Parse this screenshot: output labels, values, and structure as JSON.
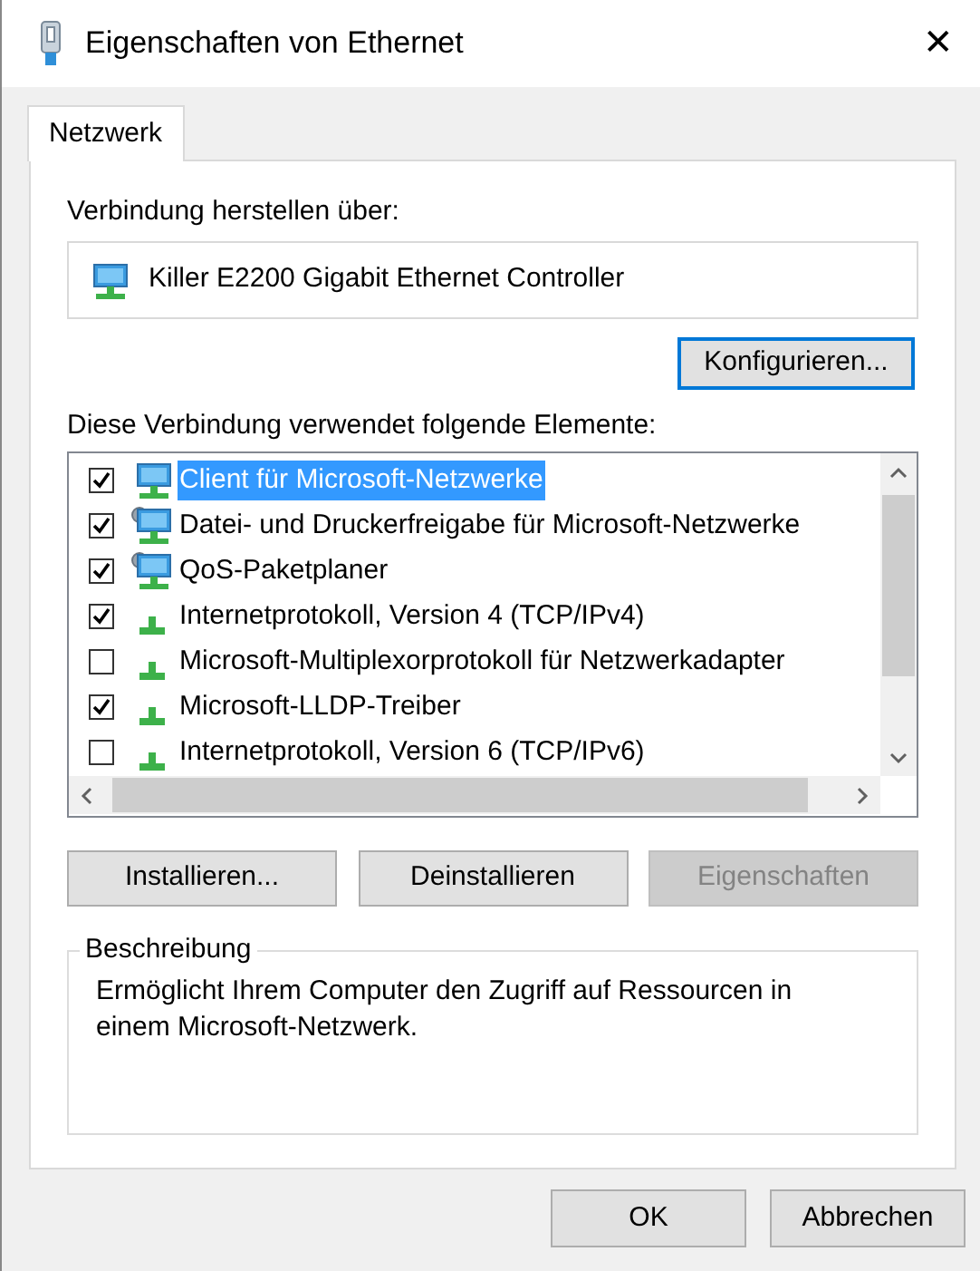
{
  "window": {
    "title": "Eigenschaften von Ethernet",
    "close": "✕"
  },
  "tabs": [
    {
      "label": "Netzwerk",
      "selected": true
    }
  ],
  "connect_label": "Verbindung herstellen über:",
  "adapter": "Killer E2200 Gigabit Ethernet Controller",
  "configure_button": {
    "label": "Konfigurieren...",
    "focused": true
  },
  "items_label": "Diese Verbindung verwendet folgende Elemente:",
  "items": [
    {
      "kind": "client",
      "label": "Client für Microsoft-Netzwerke",
      "checked": true,
      "selected": true
    },
    {
      "kind": "service",
      "label": "Datei- und Druckerfreigabe für Microsoft-Netzwerke",
      "checked": true,
      "selected": false
    },
    {
      "kind": "service",
      "label": "QoS-Paketplaner",
      "checked": true,
      "selected": false
    },
    {
      "kind": "protocol",
      "label": "Internetprotokoll, Version 4 (TCP/IPv4)",
      "checked": true,
      "selected": false
    },
    {
      "kind": "protocol",
      "label": "Microsoft-Multiplexorprotokoll für Netzwerkadapter",
      "checked": false,
      "selected": false
    },
    {
      "kind": "protocol",
      "label": "Microsoft-LLDP-Treiber",
      "checked": true,
      "selected": false
    },
    {
      "kind": "protocol",
      "label": "Internetprotokoll, Version 6 (TCP/IPv6)",
      "checked": false,
      "selected": false
    }
  ],
  "item_buttons": [
    {
      "label": "Installieren...",
      "disabled": false
    },
    {
      "label": "Deinstallieren",
      "disabled": false
    },
    {
      "label": "Eigenschaften",
      "disabled": true
    }
  ],
  "description": {
    "title": "Beschreibung",
    "text": "Ermöglicht Ihrem Computer den Zugriff auf Ressourcen in einem Microsoft-Netzwerk."
  },
  "dialog_buttons": [
    {
      "label": "OK"
    },
    {
      "label": "Abbrechen"
    }
  ]
}
